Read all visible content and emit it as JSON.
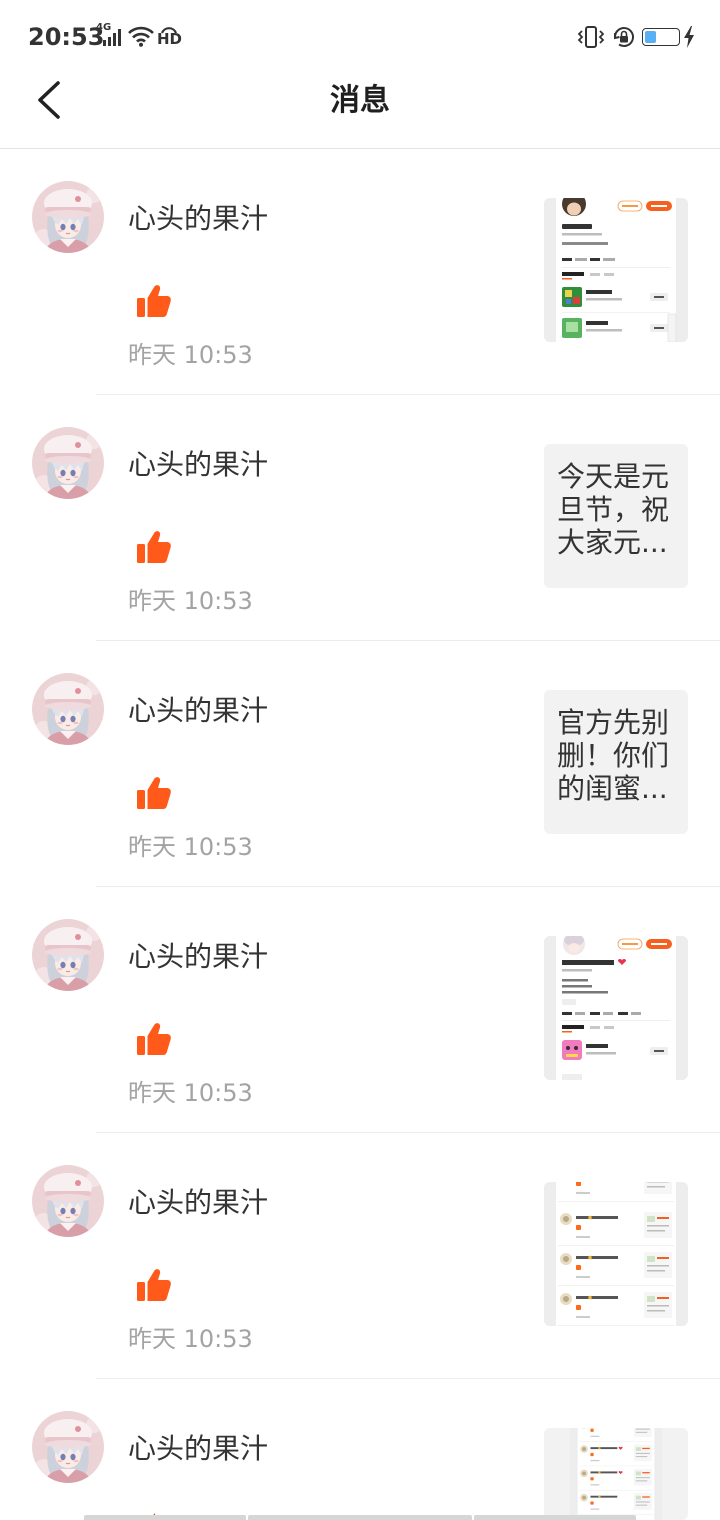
{
  "status_bar": {
    "time": "20:53",
    "network_label": "4G",
    "hd_label": "HD",
    "icons": [
      "signal-icon",
      "wifi-icon",
      "hd-voice-icon",
      "vibrate-icon",
      "rotation-lock-icon",
      "battery-icon",
      "charging-icon"
    ],
    "battery_level": 0.35
  },
  "header": {
    "title": "消息",
    "back_icon": "chevron-left-icon"
  },
  "colors": {
    "accent": "#ff5a1a",
    "text_primary": "#333333",
    "text_secondary": "#a3a3a3",
    "divider": "#ececec",
    "thumbnail_bg": "#f2f2f2",
    "battery_fill": "#5ab0f5"
  },
  "messages": [
    {
      "name": "心头的果汁",
      "time": "昨天 10:53",
      "avatar_image": "user-avatar-image",
      "action_icon": "thumbs-up-icon",
      "thumbnail_image": "profile-screenshot-a"
    },
    {
      "name": "心头的果汁",
      "time": "昨天 10:53",
      "avatar_image": "user-avatar-image",
      "action_icon": "thumbs-up-icon",
      "thumbnail_text": "今天是元旦节，祝大家元..."
    },
    {
      "name": "心头的果汁",
      "time": "昨天 10:53",
      "avatar_image": "user-avatar-image",
      "action_icon": "thumbs-up-icon",
      "thumbnail_text": "官方先别删！你们的闺蜜..."
    },
    {
      "name": "心头的果汁",
      "time": "昨天 10:53",
      "avatar_image": "user-avatar-image",
      "action_icon": "thumbs-up-icon",
      "thumbnail_image": "profile-screenshot-b"
    },
    {
      "name": "心头的果汁",
      "time": "昨天 10:53",
      "avatar_image": "user-avatar-image",
      "action_icon": "thumbs-up-icon",
      "thumbnail_image": "message-list-screenshot-a"
    },
    {
      "name": "心头的果汁",
      "avatar_image": "user-avatar-image",
      "action_icon": "thumbs-up-icon",
      "thumbnail_image": "message-list-screenshot-b"
    }
  ]
}
